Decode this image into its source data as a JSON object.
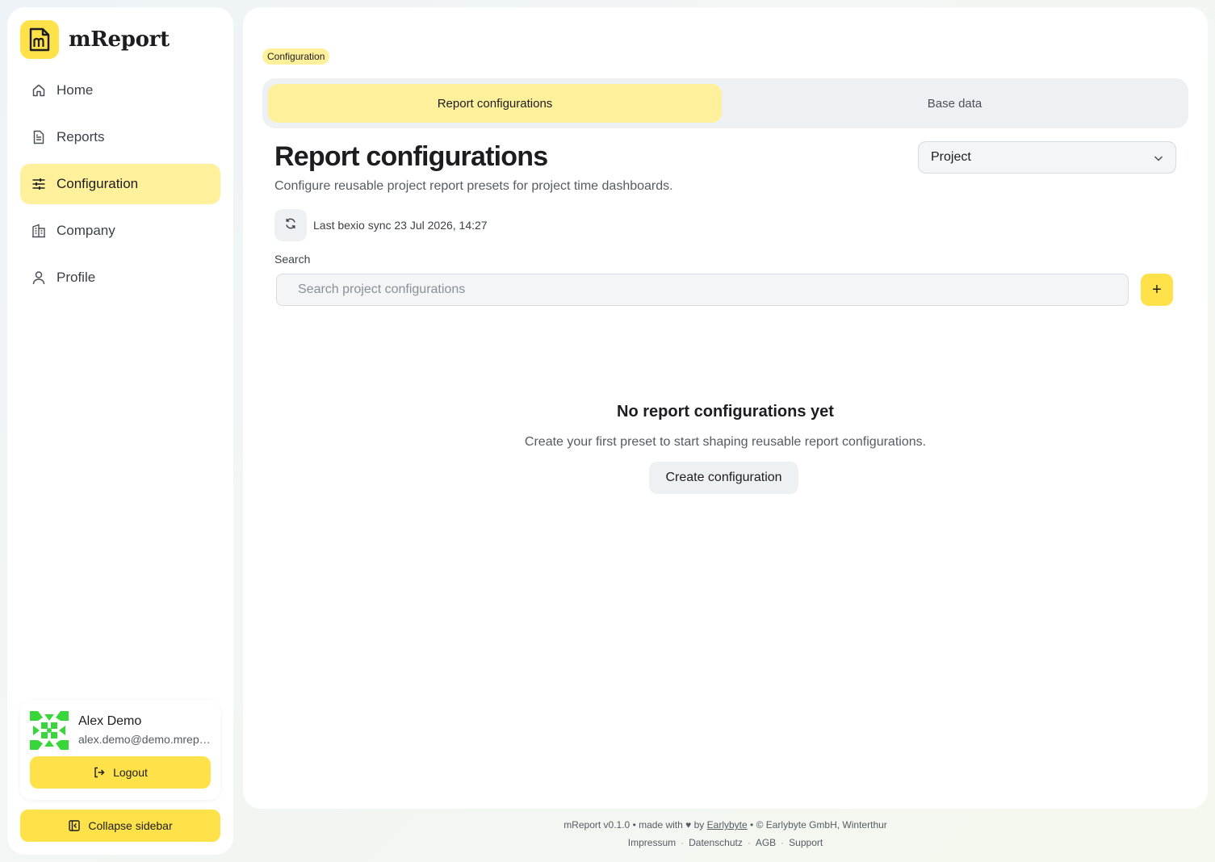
{
  "brand": {
    "name": "mReport"
  },
  "sidebar": {
    "items": [
      {
        "label": "Home",
        "icon": "home-icon"
      },
      {
        "label": "Reports",
        "icon": "document-icon"
      },
      {
        "label": "Configuration",
        "icon": "sliders-icon",
        "active": true
      },
      {
        "label": "Company",
        "icon": "building-icon"
      },
      {
        "label": "Profile",
        "icon": "user-icon"
      }
    ],
    "user": {
      "name": "Alex Demo",
      "email": "alex.demo@demo.mreport.ch"
    },
    "logout_label": "Logout",
    "collapse_label": "Collapse sidebar"
  },
  "main": {
    "breadcrumb": "Configuration",
    "tabs": [
      {
        "label": "Report configurations",
        "active": true
      },
      {
        "label": "Base data",
        "active": false
      }
    ],
    "title": "Report configurations",
    "subtitle": "Configure reusable project report presets for project time dashboards.",
    "select_value": "Project",
    "sync_text": "Last bexio sync 23 Jul 2026, 14:27",
    "search_label": "Search",
    "search_placeholder": "Search project configurations",
    "add_label": "+",
    "empty_title": "No report configurations yet",
    "empty_subtitle": "Create your first preset to start shaping reusable report configurations.",
    "create_label": "Create configuration"
  },
  "footer": {
    "version": "mReport v0.1.0",
    "made_with": "• made with",
    "heart": "♥",
    "by": "by",
    "company_link": "Earlybyte",
    "copyright": "• © Earlybyte GmbH, Winterthur",
    "links": [
      "Impressum",
      "Datenschutz",
      "AGB",
      "Support"
    ]
  },
  "colors": {
    "accent": "#ffe24a",
    "accent_soft": "#fff09c",
    "surface": "#eef1f4"
  }
}
